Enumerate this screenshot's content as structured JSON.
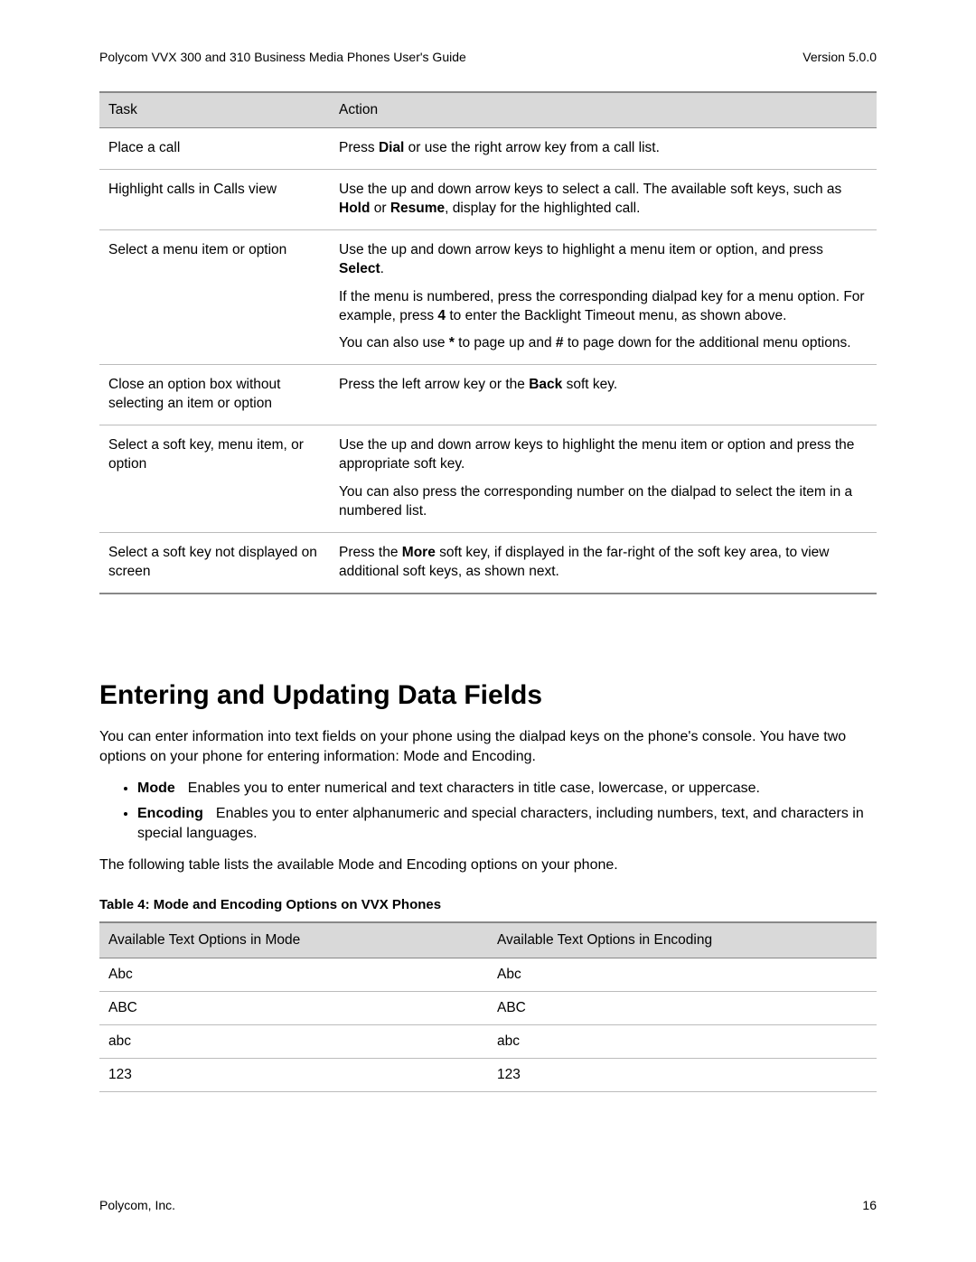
{
  "header": {
    "title": "Polycom VVX 300 and 310 Business Media Phones User's Guide",
    "version": "Version 5.0.0"
  },
  "task_table": {
    "headers": {
      "task": "Task",
      "action": "Action"
    },
    "rows": [
      {
        "task": "Place a call",
        "action_html": "Press <b>Dial</b> or use the right arrow key from a call list."
      },
      {
        "task": "Highlight calls in Calls view",
        "action_html": "Use the up and down arrow keys to select a call. The available soft keys, such as <b>Hold</b> or <b>Resume</b>, display for the highlighted call."
      },
      {
        "task": "Select a menu item or option",
        "action_html": "<div class=\"para\">Use the up and down arrow keys to highlight a menu item or option, and press <b>Select</b>.</div><div class=\"para\">If the menu is numbered, press the corresponding dialpad key for a menu option. For example, press <b>4</b> to enter the Backlight Timeout menu, as shown above.</div><div class=\"para\">You can also use <b>*</b> to page up and <b>#</b> to page down for the additional menu options.</div>"
      },
      {
        "task": "Close an option box without selecting an item or option",
        "action_html": "Press the left arrow key or the <b>Back</b> soft key."
      },
      {
        "task": "Select a soft key, menu item, or option",
        "action_html": "<div class=\"para\">Use the up and down arrow keys to highlight the menu item or option and press the appropriate soft key.</div><div class=\"para\">You can also press the corresponding number on the dialpad to select the item in a numbered list.</div>"
      },
      {
        "task": "Select a soft key not displayed on screen",
        "action_html": "Press the <b>More</b> soft key, if displayed in the far-right of the soft key area, to view additional soft keys, as shown next."
      }
    ]
  },
  "section": {
    "heading": "Entering and Updating Data Fields",
    "intro": "You can enter information into text fields on your phone using the dialpad keys on the phone's console. You have two options on your phone for entering information: Mode and Encoding.",
    "bullets": [
      {
        "term": "Mode",
        "desc": "Enables you to enter numerical and text characters in title case, lowercase, or uppercase."
      },
      {
        "term": "Encoding",
        "desc": "Enables you to enter alphanumeric and special characters, including numbers, text, and characters in special languages."
      }
    ],
    "outro": "The following table lists the available Mode and Encoding options on your phone.",
    "table_caption": "Table 4: Mode and Encoding Options on VVX Phones",
    "opts_headers": {
      "mode": "Available Text Options in Mode",
      "encoding": "Available Text Options in Encoding"
    },
    "opts_rows": [
      {
        "mode": "Abc",
        "encoding": "Abc"
      },
      {
        "mode": "ABC",
        "encoding": "ABC"
      },
      {
        "mode": "abc",
        "encoding": "abc"
      },
      {
        "mode": "123",
        "encoding": "123"
      }
    ]
  },
  "footer": {
    "company": "Polycom, Inc.",
    "page": "16"
  }
}
